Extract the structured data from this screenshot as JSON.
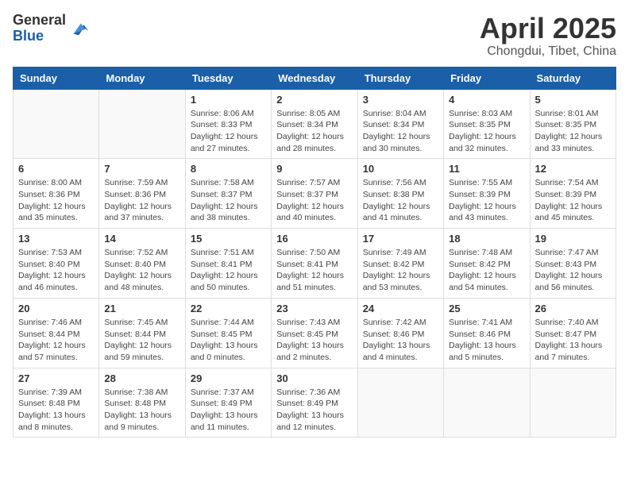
{
  "header": {
    "logo_general": "General",
    "logo_blue": "Blue",
    "month_title": "April 2025",
    "location": "Chongdui, Tibet, China"
  },
  "weekdays": [
    "Sunday",
    "Monday",
    "Tuesday",
    "Wednesday",
    "Thursday",
    "Friday",
    "Saturday"
  ],
  "weeks": [
    [
      {
        "day": "",
        "info": ""
      },
      {
        "day": "",
        "info": ""
      },
      {
        "day": "1",
        "sunrise": "Sunrise: 8:06 AM",
        "sunset": "Sunset: 8:33 PM",
        "daylight": "Daylight: 12 hours and 27 minutes."
      },
      {
        "day": "2",
        "sunrise": "Sunrise: 8:05 AM",
        "sunset": "Sunset: 8:34 PM",
        "daylight": "Daylight: 12 hours and 28 minutes."
      },
      {
        "day": "3",
        "sunrise": "Sunrise: 8:04 AM",
        "sunset": "Sunset: 8:34 PM",
        "daylight": "Daylight: 12 hours and 30 minutes."
      },
      {
        "day": "4",
        "sunrise": "Sunrise: 8:03 AM",
        "sunset": "Sunset: 8:35 PM",
        "daylight": "Daylight: 12 hours and 32 minutes."
      },
      {
        "day": "5",
        "sunrise": "Sunrise: 8:01 AM",
        "sunset": "Sunset: 8:35 PM",
        "daylight": "Daylight: 12 hours and 33 minutes."
      }
    ],
    [
      {
        "day": "6",
        "sunrise": "Sunrise: 8:00 AM",
        "sunset": "Sunset: 8:36 PM",
        "daylight": "Daylight: 12 hours and 35 minutes."
      },
      {
        "day": "7",
        "sunrise": "Sunrise: 7:59 AM",
        "sunset": "Sunset: 8:36 PM",
        "daylight": "Daylight: 12 hours and 37 minutes."
      },
      {
        "day": "8",
        "sunrise": "Sunrise: 7:58 AM",
        "sunset": "Sunset: 8:37 PM",
        "daylight": "Daylight: 12 hours and 38 minutes."
      },
      {
        "day": "9",
        "sunrise": "Sunrise: 7:57 AM",
        "sunset": "Sunset: 8:37 PM",
        "daylight": "Daylight: 12 hours and 40 minutes."
      },
      {
        "day": "10",
        "sunrise": "Sunrise: 7:56 AM",
        "sunset": "Sunset: 8:38 PM",
        "daylight": "Daylight: 12 hours and 41 minutes."
      },
      {
        "day": "11",
        "sunrise": "Sunrise: 7:55 AM",
        "sunset": "Sunset: 8:39 PM",
        "daylight": "Daylight: 12 hours and 43 minutes."
      },
      {
        "day": "12",
        "sunrise": "Sunrise: 7:54 AM",
        "sunset": "Sunset: 8:39 PM",
        "daylight": "Daylight: 12 hours and 45 minutes."
      }
    ],
    [
      {
        "day": "13",
        "sunrise": "Sunrise: 7:53 AM",
        "sunset": "Sunset: 8:40 PM",
        "daylight": "Daylight: 12 hours and 46 minutes."
      },
      {
        "day": "14",
        "sunrise": "Sunrise: 7:52 AM",
        "sunset": "Sunset: 8:40 PM",
        "daylight": "Daylight: 12 hours and 48 minutes."
      },
      {
        "day": "15",
        "sunrise": "Sunrise: 7:51 AM",
        "sunset": "Sunset: 8:41 PM",
        "daylight": "Daylight: 12 hours and 50 minutes."
      },
      {
        "day": "16",
        "sunrise": "Sunrise: 7:50 AM",
        "sunset": "Sunset: 8:41 PM",
        "daylight": "Daylight: 12 hours and 51 minutes."
      },
      {
        "day": "17",
        "sunrise": "Sunrise: 7:49 AM",
        "sunset": "Sunset: 8:42 PM",
        "daylight": "Daylight: 12 hours and 53 minutes."
      },
      {
        "day": "18",
        "sunrise": "Sunrise: 7:48 AM",
        "sunset": "Sunset: 8:42 PM",
        "daylight": "Daylight: 12 hours and 54 minutes."
      },
      {
        "day": "19",
        "sunrise": "Sunrise: 7:47 AM",
        "sunset": "Sunset: 8:43 PM",
        "daylight": "Daylight: 12 hours and 56 minutes."
      }
    ],
    [
      {
        "day": "20",
        "sunrise": "Sunrise: 7:46 AM",
        "sunset": "Sunset: 8:44 PM",
        "daylight": "Daylight: 12 hours and 57 minutes."
      },
      {
        "day": "21",
        "sunrise": "Sunrise: 7:45 AM",
        "sunset": "Sunset: 8:44 PM",
        "daylight": "Daylight: 12 hours and 59 minutes."
      },
      {
        "day": "22",
        "sunrise": "Sunrise: 7:44 AM",
        "sunset": "Sunset: 8:45 PM",
        "daylight": "Daylight: 13 hours and 0 minutes."
      },
      {
        "day": "23",
        "sunrise": "Sunrise: 7:43 AM",
        "sunset": "Sunset: 8:45 PM",
        "daylight": "Daylight: 13 hours and 2 minutes."
      },
      {
        "day": "24",
        "sunrise": "Sunrise: 7:42 AM",
        "sunset": "Sunset: 8:46 PM",
        "daylight": "Daylight: 13 hours and 4 minutes."
      },
      {
        "day": "25",
        "sunrise": "Sunrise: 7:41 AM",
        "sunset": "Sunset: 8:46 PM",
        "daylight": "Daylight: 13 hours and 5 minutes."
      },
      {
        "day": "26",
        "sunrise": "Sunrise: 7:40 AM",
        "sunset": "Sunset: 8:47 PM",
        "daylight": "Daylight: 13 hours and 7 minutes."
      }
    ],
    [
      {
        "day": "27",
        "sunrise": "Sunrise: 7:39 AM",
        "sunset": "Sunset: 8:48 PM",
        "daylight": "Daylight: 13 hours and 8 minutes."
      },
      {
        "day": "28",
        "sunrise": "Sunrise: 7:38 AM",
        "sunset": "Sunset: 8:48 PM",
        "daylight": "Daylight: 13 hours and 9 minutes."
      },
      {
        "day": "29",
        "sunrise": "Sunrise: 7:37 AM",
        "sunset": "Sunset: 8:49 PM",
        "daylight": "Daylight: 13 hours and 11 minutes."
      },
      {
        "day": "30",
        "sunrise": "Sunrise: 7:36 AM",
        "sunset": "Sunset: 8:49 PM",
        "daylight": "Daylight: 13 hours and 12 minutes."
      },
      {
        "day": "",
        "info": ""
      },
      {
        "day": "",
        "info": ""
      },
      {
        "day": "",
        "info": ""
      }
    ]
  ]
}
